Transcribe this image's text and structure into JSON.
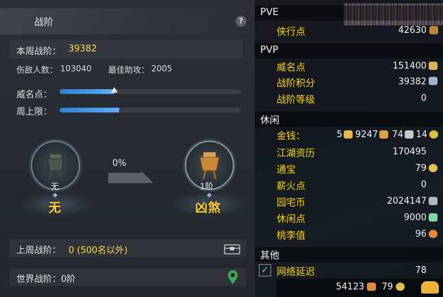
{
  "left": {
    "title": "战阶",
    "help_label": "?",
    "weekly_label": "本周战阶：",
    "weekly_value": "39382",
    "damage_count_label": "伤敌人数：",
    "damage_count_value": "103040",
    "best_assist_label": "最佳助攻：",
    "best_assist_value": "2005",
    "reputation_label": "威名点：",
    "reputation_progress": 0.3,
    "weekly_cap_label": "周上限：",
    "weekly_cap_progress": 0.33,
    "current_rank_small": "无",
    "current_rank_big": "无",
    "progress_percent": "0%",
    "next_rank_small": "1阶",
    "next_rank_big": "凶煞",
    "last_week_label": "上周战阶：",
    "last_week_value": "0 (500名以外)",
    "world_label": "世界战阶：0阶",
    "colors": {
      "accent_yellow": "#ffd94a",
      "bar_blue": "#4a98e8",
      "rank_gold": "#ffcc33"
    }
  },
  "right": {
    "pve_header": "PVE",
    "pve_items": [
      {
        "label": "侠行点",
        "value": "42630",
        "icon": "sword-icon"
      }
    ],
    "pvp_header": "PVP",
    "pvp_items": [
      {
        "label": "威名点",
        "value": "151400",
        "icon": "tiger-icon"
      },
      {
        "label": "战阶积分",
        "value": "39382",
        "icon": "crystal-icon"
      },
      {
        "label": "战阶等级",
        "value": "0",
        "icon": ""
      }
    ],
    "leisure_header": "休闲",
    "money": {
      "label": "金钱：",
      "gold": "5",
      "silver_ingots": "9247",
      "silver": "74",
      "copper": "14"
    },
    "leisure_items": [
      {
        "label": "江湖资历",
        "value": "170495",
        "icon": ""
      },
      {
        "label": "通宝",
        "value": "79",
        "icon": "coin-icon"
      },
      {
        "label": "薪火点",
        "value": "0",
        "icon": ""
      },
      {
        "label": "园宅币",
        "value": "2024147",
        "icon": "house-coin-icon"
      },
      {
        "label": "休闲点",
        "value": "9000",
        "icon": "leaf-icon"
      },
      {
        "label": "桃李值",
        "value": "96",
        "icon": "gourd-icon"
      }
    ],
    "other_header": "其他",
    "network_label": "网络延迟",
    "network_value": "78",
    "bottom_value1": "54123",
    "bottom_value2": "79"
  }
}
